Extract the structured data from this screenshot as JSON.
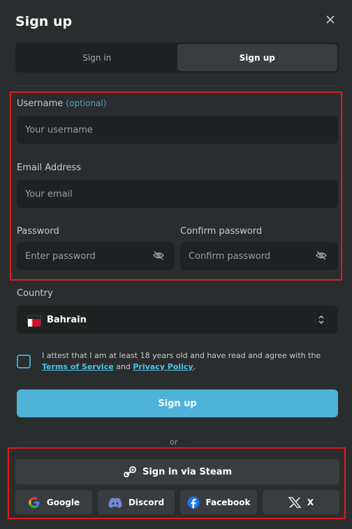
{
  "header": {
    "title": "Sign up",
    "close_icon": "close-icon"
  },
  "tabs": [
    {
      "label": "Sign in",
      "active": false
    },
    {
      "label": "Sign up",
      "active": true
    }
  ],
  "form": {
    "username": {
      "label": "Username",
      "optional": "(optional)",
      "placeholder": "Your username"
    },
    "email": {
      "label": "Email Address",
      "placeholder": "Your email"
    },
    "password": {
      "label": "Password",
      "placeholder": "Enter password"
    },
    "confirm": {
      "label": "Confirm password",
      "placeholder": "Confirm password"
    },
    "country": {
      "label": "Country",
      "value": "Bahrain"
    },
    "consent": {
      "text_before": "I attest that I am at least 18 years old and have read and agree with the ",
      "terms": "Terms of Service",
      "and": " and ",
      "privacy": "Privacy Policy",
      "end": "."
    },
    "submit": "Sign up"
  },
  "divider_text": "or",
  "social": {
    "steam": "Sign in via Steam",
    "google": "Google",
    "discord": "Discord",
    "facebook": "Facebook",
    "x": "X"
  },
  "colors": {
    "accent": "#4fb3d9",
    "link": "#4fc3ea",
    "highlight_box": "#e01b1b",
    "background": "#2a2d2e"
  }
}
